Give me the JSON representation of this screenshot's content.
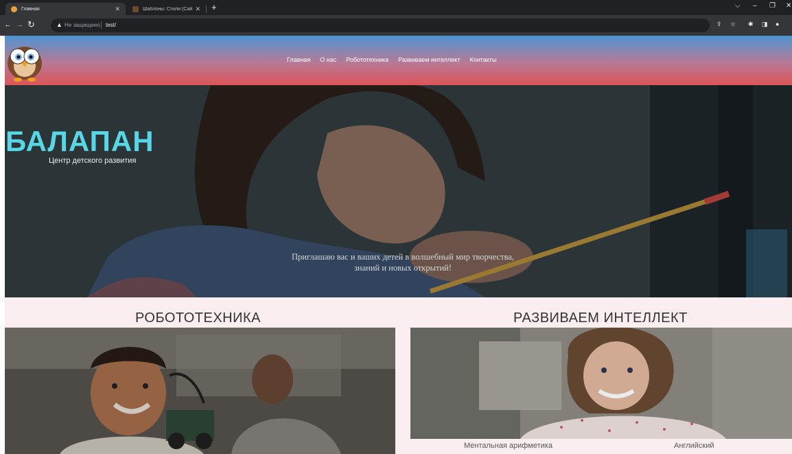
{
  "browser": {
    "tabs": [
      {
        "title": "Главная",
        "active": true
      },
      {
        "title": "Шаблоны: Стили (Сайт) - Центр",
        "active": false
      }
    ],
    "new_tab": "+",
    "address": {
      "security_label": "Не защищено",
      "url": "test/"
    },
    "window_controls": [
      "⌵",
      "–",
      "❐",
      "✕"
    ]
  },
  "site": {
    "nav": [
      "Главная",
      "О нас",
      "Робототехника",
      "Развиваем интеллект",
      "Контакты"
    ],
    "hero": {
      "title": "БАЛАПАН",
      "subtitle": "Центр детского развития",
      "tagline_1": "Приглашаю вас и ваших детей в волшебный мир творчества,",
      "tagline_2": "знаний и новых открытий!"
    },
    "sections": {
      "robotics": {
        "title": "РОБОТОТЕХНИКА"
      },
      "intellect": {
        "title": "РАЗВИВАЕМ ИНТЕЛЛЕКТ",
        "items": [
          "Ментальная арифметика",
          "Английский"
        ]
      }
    }
  },
  "colors": {
    "header_top": "#4d94d2",
    "header_bottom": "#dd5558",
    "hero_title": "#59d6e6",
    "sections_bg": "#fbeef0"
  }
}
